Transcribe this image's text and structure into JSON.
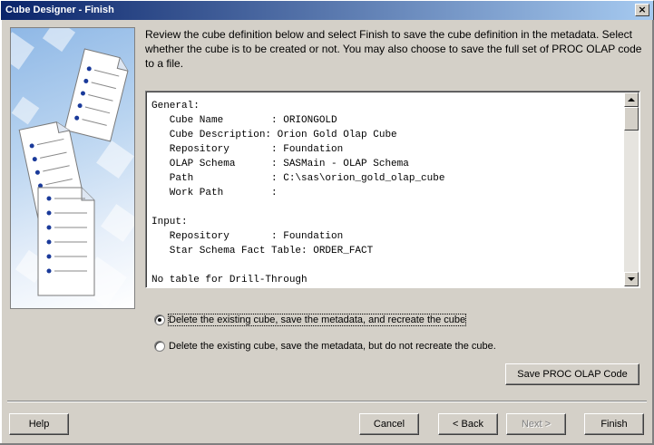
{
  "window": {
    "title": "Cube Designer - Finish",
    "close_glyph": "×"
  },
  "description": "Review the cube definition below and select Finish to save the cube definition in the metadata. Select whether the cube is to be created or not. You may also choose to save the full set of PROC OLAP code to a file.",
  "summary_text": "General:\n   Cube Name        : ORIONGOLD\n   Cube Description: Orion Gold Olap Cube\n   Repository       : Foundation\n   OLAP Schema      : SASMain - OLAP Schema\n   Path             : C:\\sas\\orion_gold_olap_cube\n   Work Path        :\n\nInput:\n   Repository       : Foundation\n   Star Schema Fact Table: ORDER_FACT\n\nNo table for Drill-Through",
  "options": [
    {
      "label": "Delete the existing cube, save the metadata, and recreate the cube",
      "selected": true
    },
    {
      "label": "Delete the existing cube, save the metadata, but do not recreate the cube.",
      "selected": false
    }
  ],
  "buttons": {
    "save_proc": "Save PROC OLAP Code",
    "help": "Help",
    "cancel": "Cancel",
    "back": "< Back",
    "next": "Next >",
    "finish": "Finish"
  },
  "colors": {
    "title_start": "#0a246a",
    "title_end": "#a6caf0",
    "dialog_bg": "#d4d0c8"
  }
}
